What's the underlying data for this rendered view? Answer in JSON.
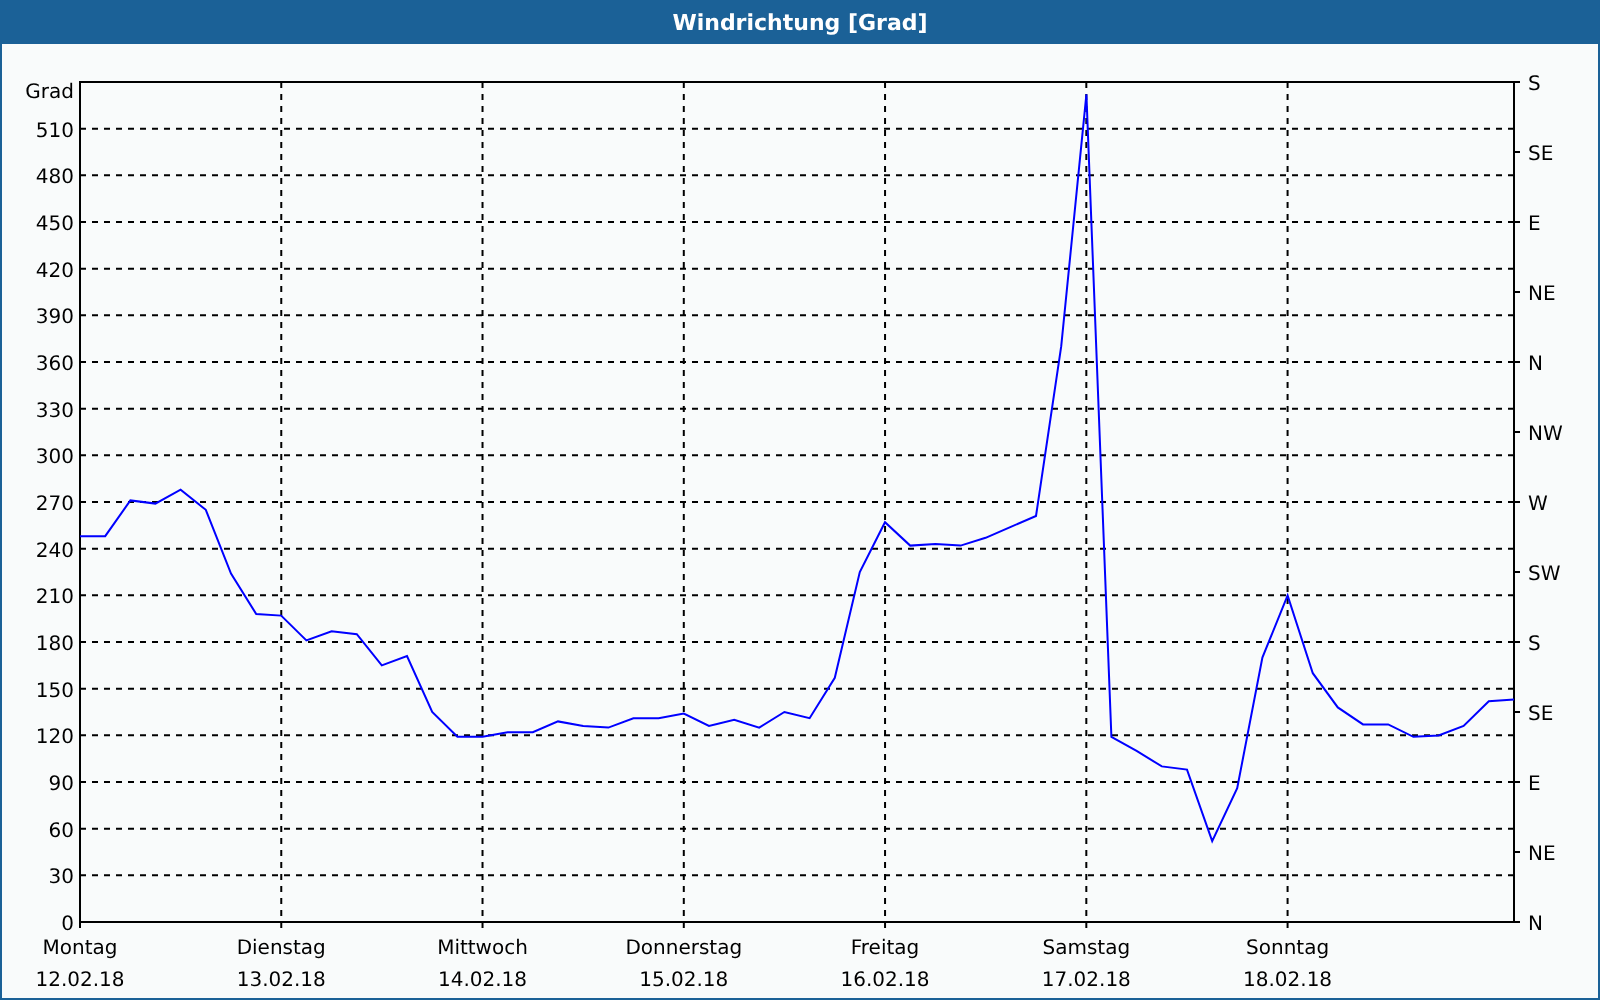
{
  "window": {
    "title": "Windrichtung [Grad]"
  },
  "chart": {
    "date_labels": [
      "12.02.18",
      "13.02.18",
      "14.02.18",
      "15.02.18",
      "16.02.18",
      "17.02.18",
      "18.02.18"
    ],
    "direction_labels": [
      "S",
      "SE",
      "E",
      "NE",
      "N",
      "NW",
      "W",
      "SW",
      "S",
      "SE",
      "E",
      "NE",
      "N"
    ],
    "chart_data": {
      "type": "line",
      "grid": true,
      "ylabel": "Grad",
      "ylim": [
        0,
        540
      ],
      "yticks": [
        0,
        30,
        60,
        90,
        120,
        150,
        180,
        210,
        240,
        270,
        300,
        330,
        360,
        390,
        420,
        450,
        480,
        510
      ],
      "categories": [
        "Montag",
        null,
        null,
        null,
        null,
        null,
        null,
        null,
        "Dienstag",
        null,
        null,
        null,
        null,
        null,
        null,
        null,
        "Mittwoch",
        null,
        null,
        null,
        null,
        null,
        null,
        null,
        "Donnerstag",
        null,
        null,
        null,
        null,
        null,
        null,
        null,
        "Freitag",
        null,
        null,
        null,
        null,
        null,
        null,
        null,
        "Samstag",
        null,
        null,
        null,
        null,
        null,
        null,
        null,
        "Sonntag",
        null,
        null,
        null,
        null,
        null,
        null,
        null,
        null,
        null
      ],
      "series": [
        {
          "color": "#0000ff",
          "values": [
            248,
            248,
            271,
            269,
            278,
            265,
            224,
            198,
            197,
            181,
            187,
            185,
            165,
            171,
            135,
            119,
            119,
            122,
            122,
            129,
            126,
            125,
            131,
            131,
            134,
            126,
            130,
            125,
            135,
            131,
            157,
            225,
            257,
            242,
            243,
            242,
            247,
            254,
            261,
            370,
            532,
            119,
            110,
            100,
            98,
            52,
            86,
            170,
            210,
            160,
            138,
            127,
            127,
            119,
            120,
            126,
            142,
            143
          ]
        }
      ]
    }
  }
}
